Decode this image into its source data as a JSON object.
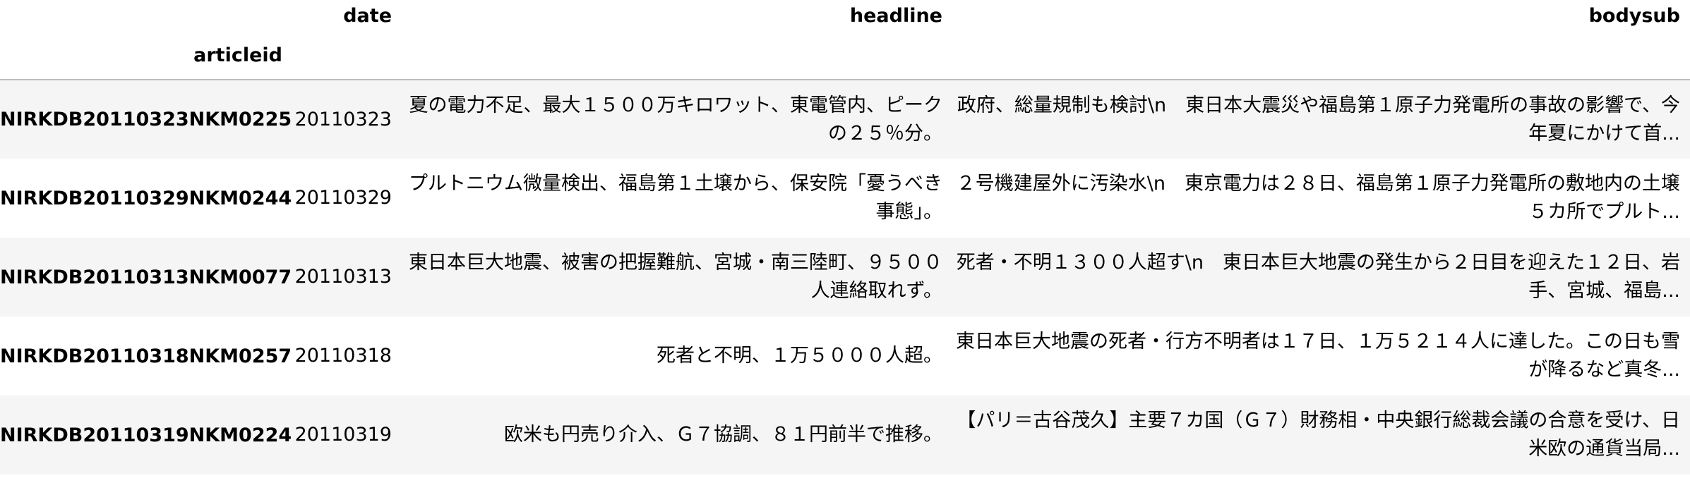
{
  "table": {
    "columns": [
      "date",
      "headline",
      "bodysub"
    ],
    "index_name": "articleid",
    "rows": [
      {
        "articleid": "NIRKDB20110323NKM0225",
        "date": "20110323",
        "headline": "夏の電力不足、最大１５００万キロワット、東電管内、ピークの２５％分。",
        "bodysub": "政府、総量規制も検討\\n　東日本大震災や福島第１原子力発電所の事故の影響で、今年夏にかけて首..."
      },
      {
        "articleid": "NIRKDB20110329NKM0244",
        "date": "20110329",
        "headline": "プルトニウム微量検出、福島第１土壌から、保安院「憂うべき事態」。",
        "bodysub": "２号機建屋外に汚染水\\n　東京電力は２８日、福島第１原子力発電所の敷地内の土壌５カ所でプルト..."
      },
      {
        "articleid": "NIRKDB20110313NKM0077",
        "date": "20110313",
        "headline": "東日本巨大地震、被害の把握難航、宮城・南三陸町、９５００人連絡取れず。",
        "bodysub": "死者・不明１３００人超す\\n　東日本巨大地震の発生から２日目を迎えた１２日、岩手、宮城、福島..."
      },
      {
        "articleid": "NIRKDB20110318NKM0257",
        "date": "20110318",
        "headline": "死者と不明、１万５０００人超。",
        "bodysub": "東日本巨大地震の死者・行方不明者は１７日、１万５２１４人に達した。この日も雪が降るなど真冬..."
      },
      {
        "articleid": "NIRKDB20110319NKM0224",
        "date": "20110319",
        "headline": "欧米も円売り介入、Ｇ７協調、８１円前半で推移。",
        "bodysub": "【パリ＝古谷茂久】主要７カ国（Ｇ７）財務相・中央銀行総裁会議の合意を受け、日米欧の通貨当局..."
      }
    ]
  }
}
